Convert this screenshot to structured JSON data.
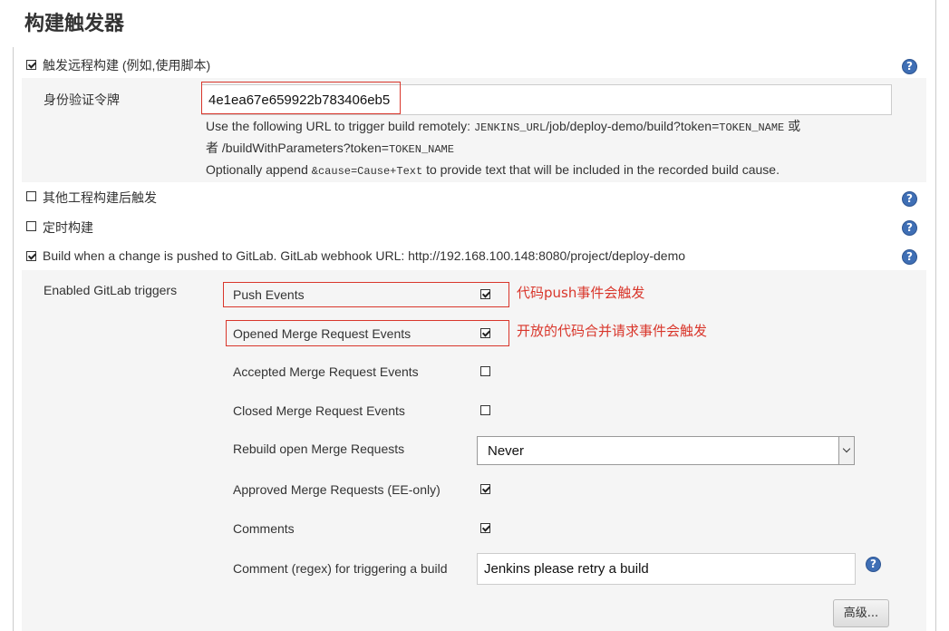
{
  "section_title": "构建触发器",
  "remote_trigger": {
    "label": "触发远程构建 (例如,使用脚本)",
    "checked": true,
    "token_label": "身份验证令牌",
    "token_value": "4e1ea67e659922b783406eb5",
    "help_line1_a": "Use the following URL to trigger build remotely: ",
    "help_line1_code": "JENKINS_URL",
    "help_line1_b": "/job/deploy-demo/build?token=",
    "help_line1_code2": "TOKEN_NAME",
    "help_line1_c": " 或",
    "help_line2_a": "者 /buildWithParameters?token=",
    "help_line2_code": "TOKEN_NAME",
    "help_line3_a": "Optionally append ",
    "help_line3_code": "&cause=Cause+Text",
    "help_line3_b": " to provide text that will be included in the recorded build cause."
  },
  "other_project_trigger": {
    "label": "其他工程构建后触发",
    "checked": false
  },
  "scheduled_build": {
    "label": "定时构建",
    "checked": false
  },
  "gitlab_trigger": {
    "label": "Build when a change is pushed to GitLab. GitLab webhook URL: http://192.168.100.148:8080/project/deploy-demo",
    "checked": true
  },
  "gitlab": {
    "section_label": "Enabled GitLab triggers",
    "push_events": {
      "label": "Push Events",
      "checked": true,
      "annotation": "代码push事件会触发"
    },
    "opened_mr": {
      "label": "Opened Merge Request Events",
      "checked": true,
      "annotation": "开放的代码合并请求事件会触发"
    },
    "accepted_mr": {
      "label": "Accepted Merge Request Events",
      "checked": false
    },
    "closed_mr": {
      "label": "Closed Merge Request Events",
      "checked": false
    },
    "rebuild_open_mr": {
      "label": "Rebuild open Merge Requests",
      "value": "Never"
    },
    "approved_mr": {
      "label": "Approved Merge Requests (EE-only)",
      "checked": true
    },
    "comments": {
      "label": "Comments",
      "checked": true
    },
    "comment_regex": {
      "label": "Comment (regex) for triggering a build",
      "value": "Jenkins please retry a build"
    },
    "advanced_button": "高级..."
  },
  "help_icon_glyph": "?",
  "colors": {
    "annotation_red": "#d9362b",
    "help_blue": "#3f6fb5",
    "panel_bg": "#f5f5f5"
  }
}
